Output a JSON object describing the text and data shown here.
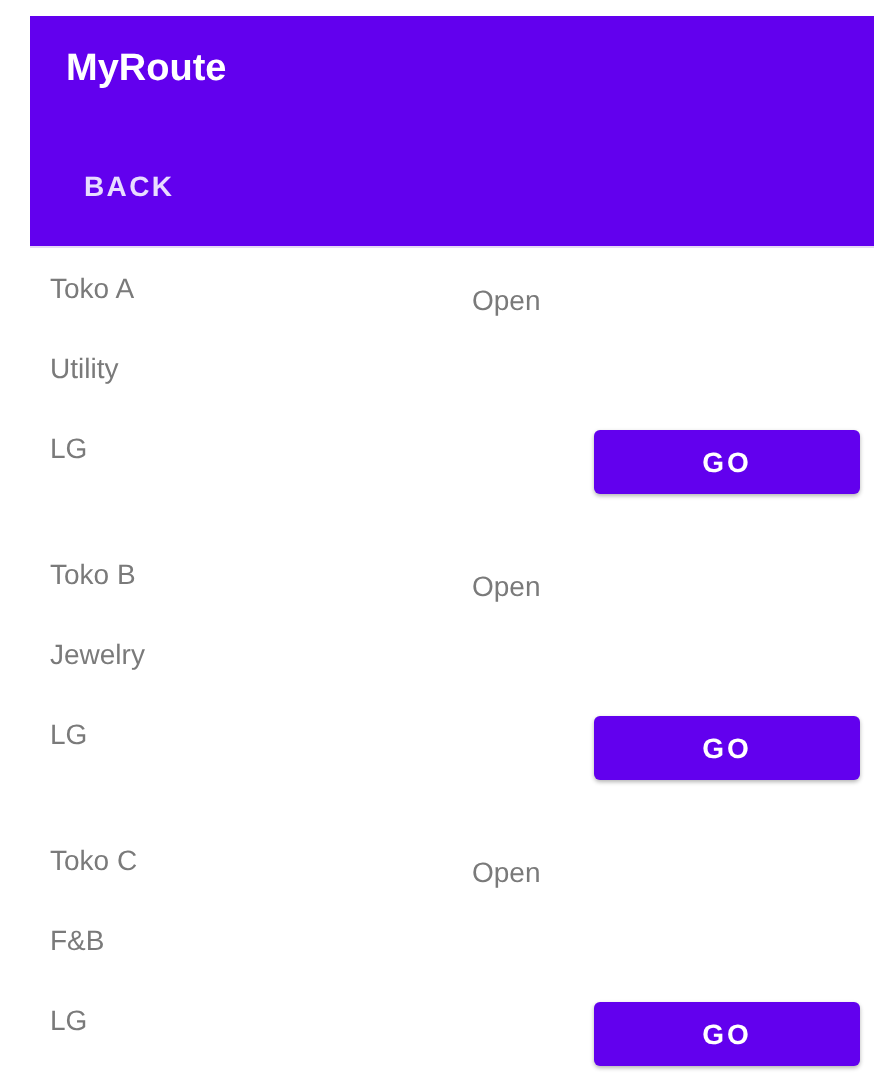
{
  "app_bar": {
    "title": "MyRoute"
  },
  "toolbar": {
    "back_button": "BACK"
  },
  "stores": [
    {
      "name": "Toko A",
      "status": "Open",
      "category": "Utility",
      "code": "LG",
      "button": "GO"
    },
    {
      "name": "Toko B",
      "status": "Open",
      "category": "Jewelry",
      "code": "LG",
      "button": "GO"
    },
    {
      "name": "Toko C",
      "status": "Open",
      "category": "F&B",
      "code": "LG",
      "button": "GO"
    }
  ]
}
